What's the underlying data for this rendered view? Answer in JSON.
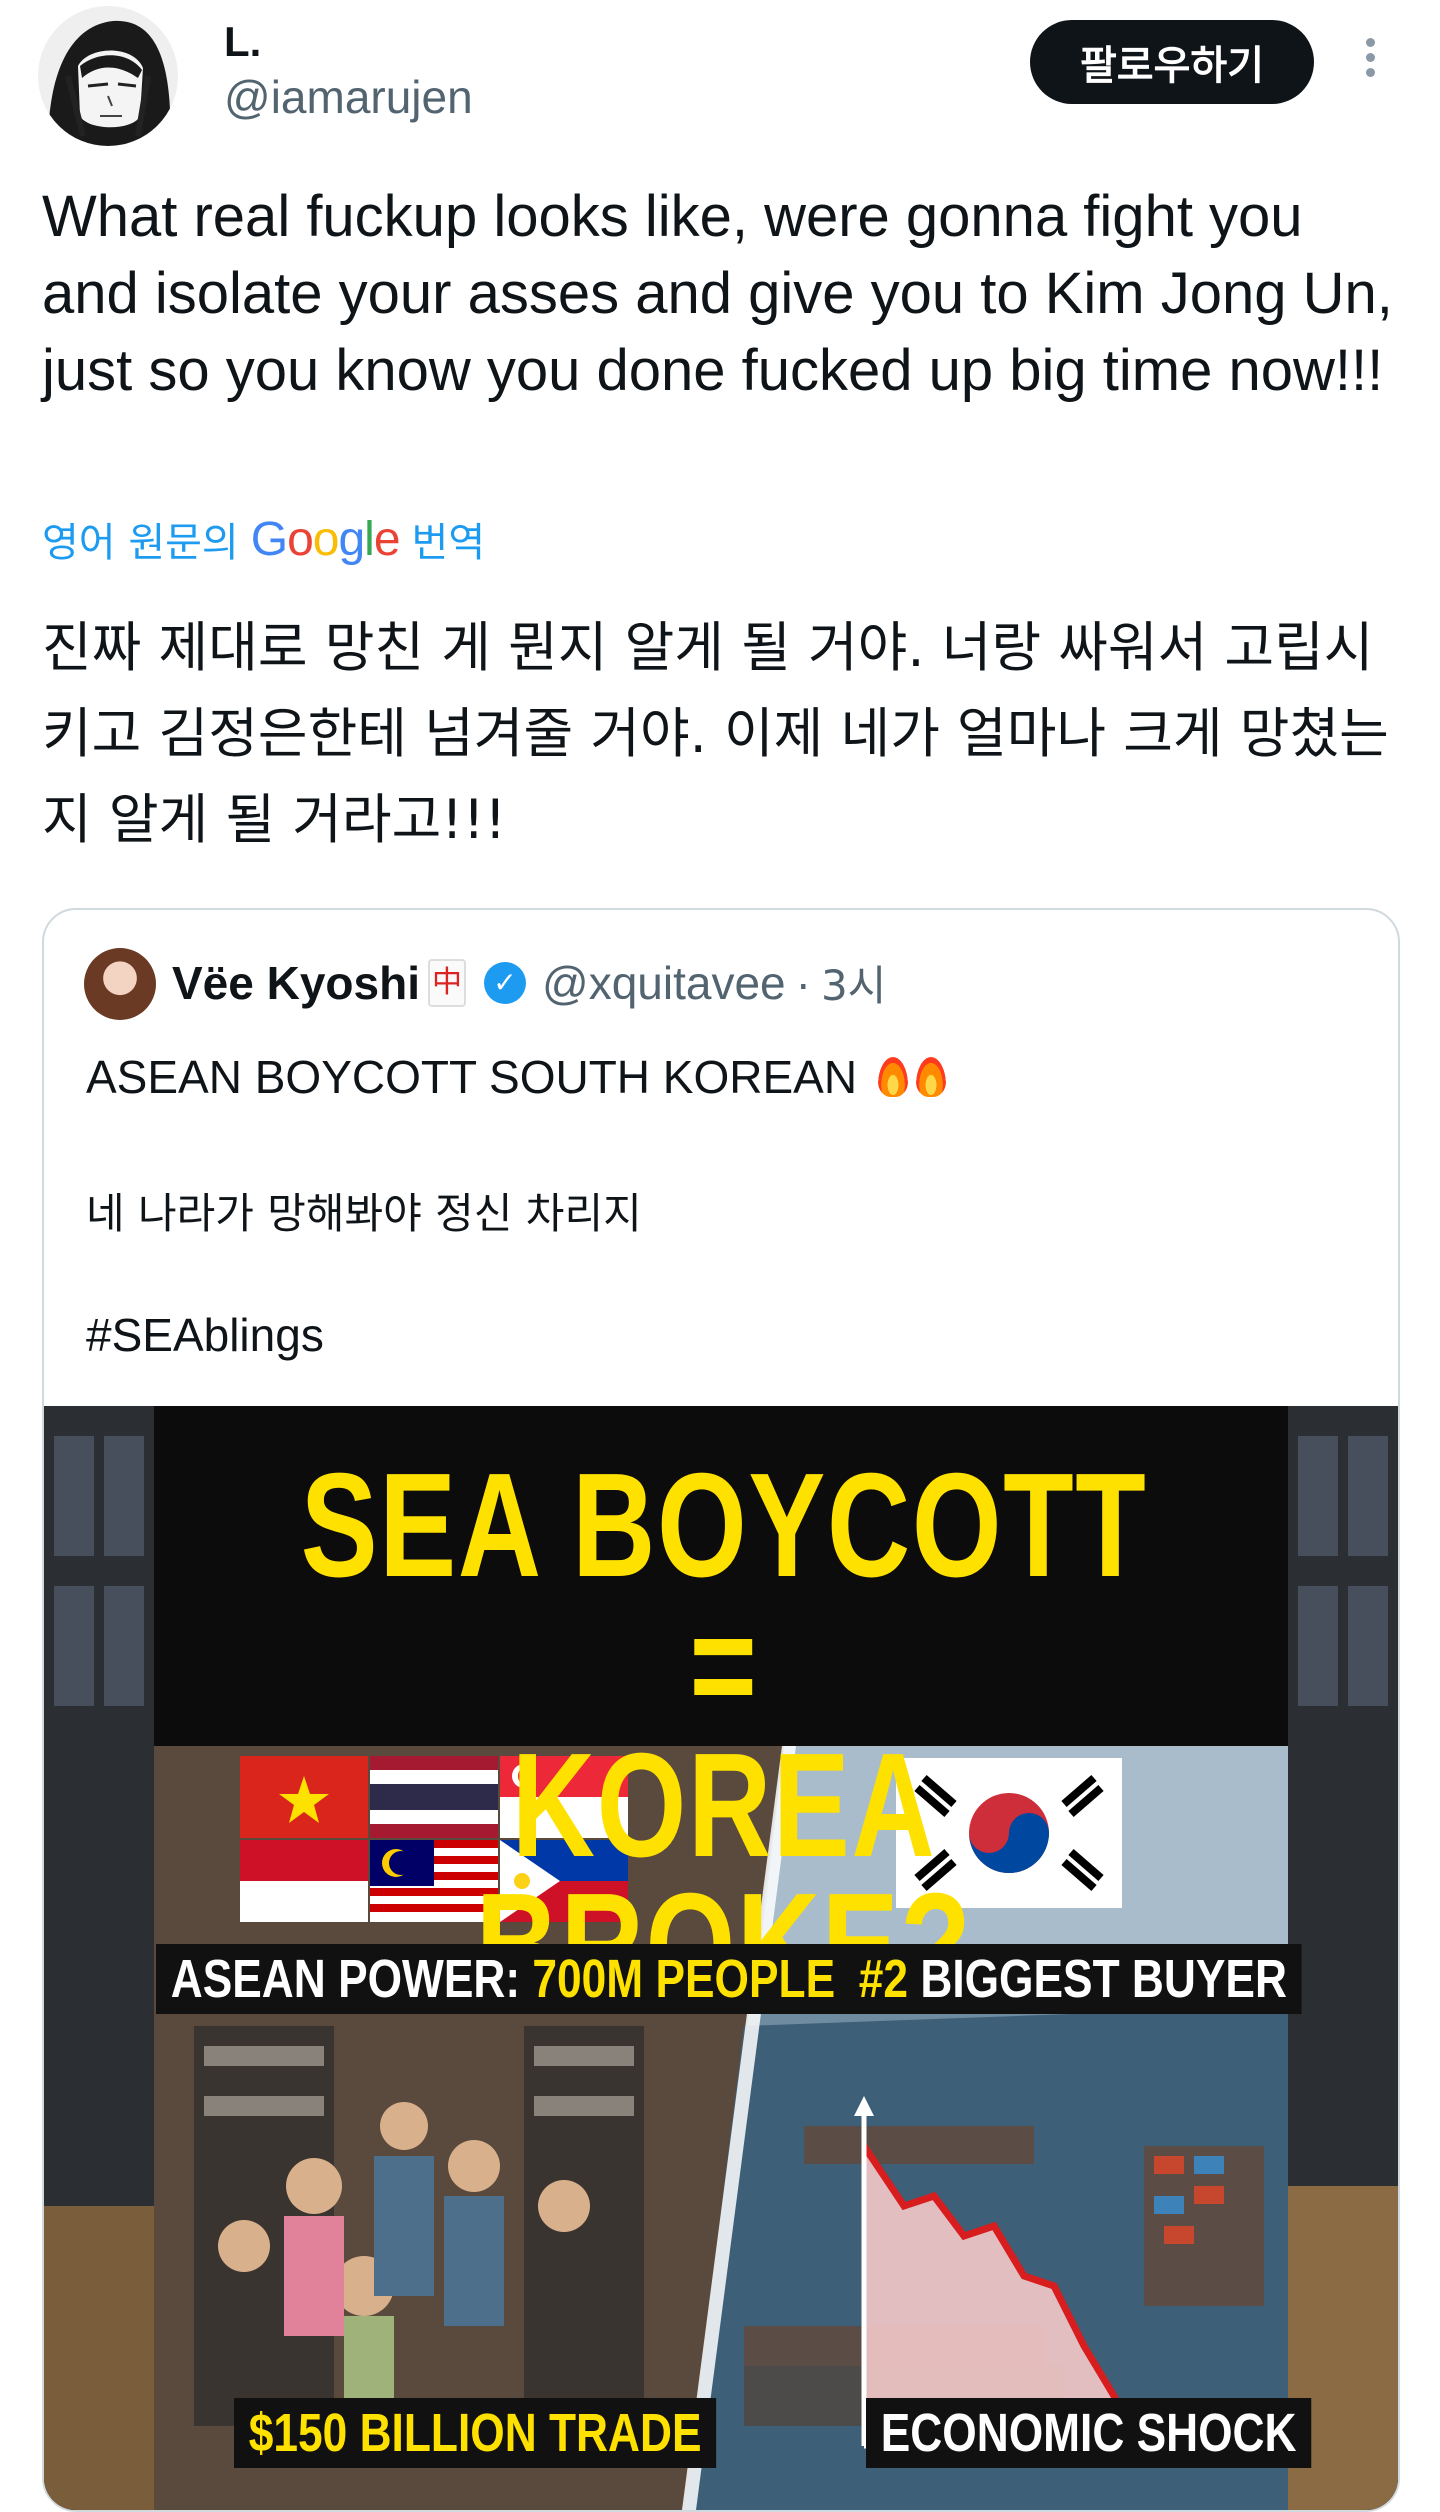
{
  "author": {
    "name": "L.",
    "handle": "@iamarujen"
  },
  "header": {
    "follow_label": "팔로우하기",
    "more_icon": "more-vertical-icon"
  },
  "tweet": {
    "text": "What real fuckup looks like, were gonna fight you and isolate your asses and give you to Kim Jong Un, just so you know you done fucked up big time now!!!",
    "translate_prefix": "영어 원문의",
    "translate_brand": "Google",
    "translate_suffix": "번역",
    "translated_text": "진짜 제대로 망친 게 뭔지 알게 될 거야. 너랑 싸워서 고립시키고 김정은한테 넘겨줄 거야. 이제 네가 얼마나 크게 망쳤는지 알게 될 거라고!!!"
  },
  "quote": {
    "name": "Vëe Kyoshi",
    "handle": "@xquitavee",
    "time": "3시",
    "text_line1": "ASEAN BOYCOTT SOUTH KOREAN",
    "text_line2": "네 나라가 망해봐야 정신 차리지",
    "hashtag": "#SEAblings",
    "image": {
      "headline_line1": "SEA BOYCOTT =",
      "headline_line2": "KOREA BROKE?",
      "label_asean_prefix": "ASEAN POWER:",
      "label_asean_value": "700M PEOPLE",
      "label_buyer_rank": "#2",
      "label_buyer_text": "BIGGEST BUYER",
      "label_trade": "$150 BILLION TRADE",
      "label_shock": "ECONOMIC SHOCK"
    }
  },
  "colors": {
    "link_blue": "#1d9bf0",
    "headline_yellow": "#ffe100",
    "follow_bg": "#0f1419"
  }
}
